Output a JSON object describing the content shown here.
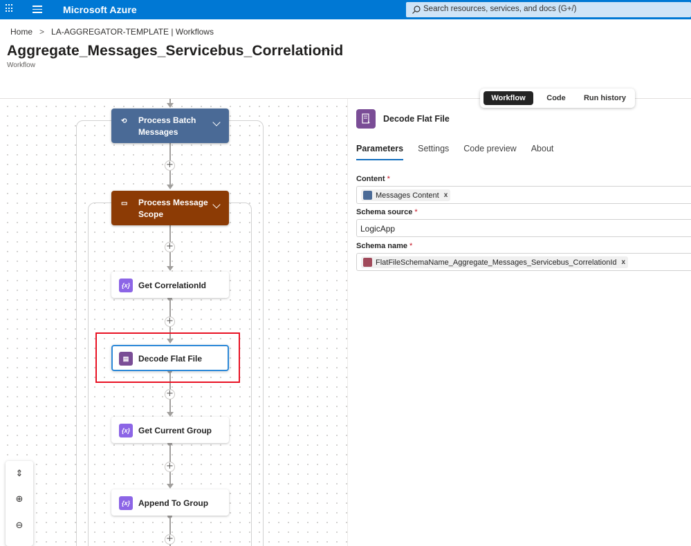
{
  "topbar": {
    "brand": "Microsoft Azure",
    "search_placeholder": "Search resources, services, and docs (G+/)"
  },
  "breadcrumb": {
    "home": "Home",
    "separator": ">",
    "resource": "LA-AGGREGATOR-TEMPLATE | Workflows"
  },
  "header": {
    "title": "Aggregate_Messages_Servicebus_Correlationid",
    "more": "···",
    "subtitle": "Workflow"
  },
  "view_toggle": {
    "items": [
      "Workflow",
      "Code",
      "Run history"
    ],
    "active": "Workflow"
  },
  "canvas": {
    "nodes": [
      {
        "label_line1": "Process Batch",
        "label_line2": "Messages",
        "color": "#4a6a96"
      },
      {
        "label_line1": "Process Message",
        "label_line2": "Scope",
        "color": "#8c3b05"
      },
      {
        "label": "Get CorrelationId"
      },
      {
        "label": "Decode Flat File",
        "selected": true
      },
      {
        "label": "Get Current Group"
      },
      {
        "label": "Append To Group"
      }
    ],
    "plus": "+",
    "highlight_color": "#e81123"
  },
  "zoom": {
    "fit": "⇕",
    "zoom_in": "⊕",
    "zoom_out": "⊖"
  },
  "panel": {
    "title": "Decode Flat File",
    "tabs": [
      "Parameters",
      "Settings",
      "Code preview",
      "About"
    ],
    "active_tab": "Parameters",
    "fields": [
      {
        "label": "Content",
        "required": "*",
        "token": "Messages Content",
        "token_color": "#4a6a96"
      },
      {
        "label": "Schema source",
        "required": "*",
        "value": "LogicApp"
      },
      {
        "label": "Schema name",
        "required": "*",
        "token": "FlatFileSchemaName_Aggregate_Messages_Servicebus_CorrelationId",
        "token_color": "#a0495a"
      }
    ],
    "token_remove": "x"
  }
}
